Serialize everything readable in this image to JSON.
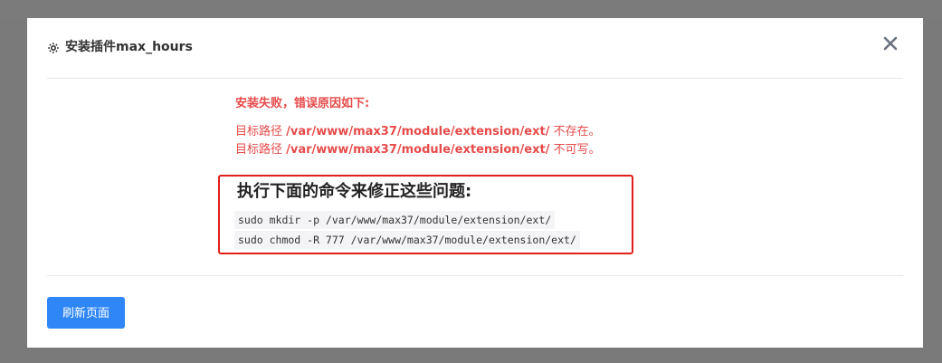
{
  "dialog": {
    "title": "安装插件max_hours",
    "gear_icon": "gear-icon",
    "close_icon": "close-icon"
  },
  "error": {
    "heading": "安装失败，错误原因如下:",
    "lines": [
      {
        "prefix": "目标路径 ",
        "path": "/var/www/max37/module/extension/ext/",
        "suffix": " 不存在。"
      },
      {
        "prefix": "目标路径 ",
        "path": "/var/www/max37/module/extension/ext/",
        "suffix": " 不可写。"
      }
    ]
  },
  "fix": {
    "title": "执行下面的命令来修正这些问题:",
    "commands": [
      "sudo mkdir -p /var/www/max37/module/extension/ext/",
      "sudo chmod -R 777 /var/www/max37/module/extension/ext/"
    ]
  },
  "footer": {
    "refresh_label": "刷新页面"
  },
  "colors": {
    "error_text": "#e64b4b",
    "highlight_border": "#e0201d",
    "primary_button": "#2f86f6",
    "backdrop": "#7a7a7a"
  }
}
